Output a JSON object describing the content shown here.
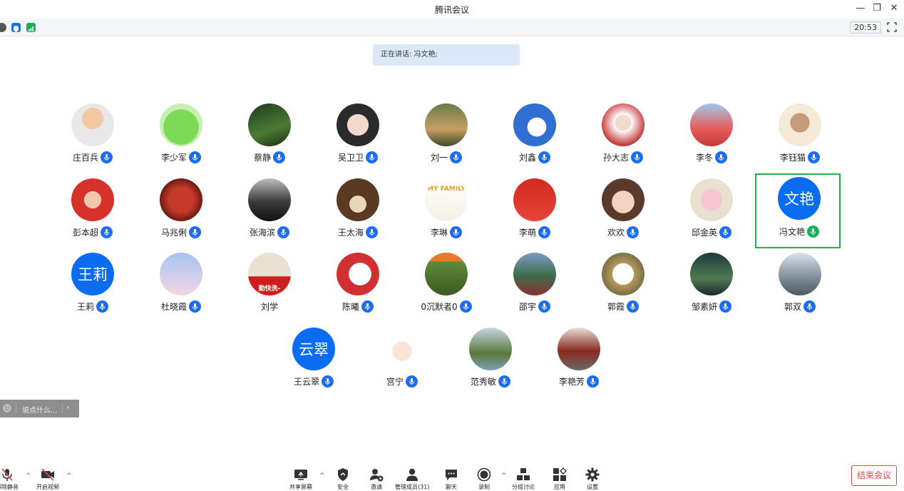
{
  "window": {
    "title": "腾讯会议"
  },
  "status": {
    "time": "20:53"
  },
  "speaking": {
    "text": "正在讲话: 冯文艳;"
  },
  "participants": [
    {
      "name": "庄百兵",
      "avatar": "photo"
    },
    {
      "name": "李少军",
      "avatar": "photo"
    },
    {
      "name": "蔡静",
      "avatar": "photo"
    },
    {
      "name": "吴卫卫",
      "avatar": "photo"
    },
    {
      "name": "刘一",
      "avatar": "photo"
    },
    {
      "name": "刘鑫",
      "avatar": "photo"
    },
    {
      "name": "孙大志",
      "avatar": "photo"
    },
    {
      "name": "李冬",
      "avatar": "photo"
    },
    {
      "name": "李钰猫",
      "avatar": "photo"
    },
    {
      "name": "彭本超",
      "avatar": "photo"
    },
    {
      "name": "马兆俐",
      "avatar": "photo"
    },
    {
      "name": "张海滨",
      "avatar": "photo"
    },
    {
      "name": "王太海",
      "avatar": "photo"
    },
    {
      "name": "李琳",
      "avatar": "photo",
      "avatar_caption": "MY FAMILY"
    },
    {
      "name": "李萌",
      "avatar": "photo"
    },
    {
      "name": "欢欢",
      "avatar": "photo"
    },
    {
      "name": "邱金英",
      "avatar": "photo"
    },
    {
      "name": "冯文艳",
      "avatar": "text",
      "avatar_text": "文艳",
      "speaking": true
    },
    {
      "name": "王莉",
      "avatar": "text",
      "avatar_text": "王莉"
    },
    {
      "name": "杜晓霞",
      "avatar": "photo"
    },
    {
      "name": "刘学",
      "avatar": "photo",
      "avatar_caption": "勤快洗-",
      "no_mic": true
    },
    {
      "name": "陈曦",
      "avatar": "photo"
    },
    {
      "name": "0沉默者0",
      "avatar": "photo"
    },
    {
      "name": "邵宇",
      "avatar": "photo"
    },
    {
      "name": "郭霞",
      "avatar": "photo"
    },
    {
      "name": "邹素妍",
      "avatar": "photo"
    },
    {
      "name": "郭双",
      "avatar": "photo"
    },
    {
      "name": "王云翠",
      "avatar": "text",
      "avatar_text": "云翠"
    },
    {
      "name": "宫宁",
      "avatar": "photo"
    },
    {
      "name": "范秀敏",
      "avatar": "photo"
    },
    {
      "name": "李艳芳",
      "avatar": "photo"
    }
  ],
  "chat": {
    "placeholder": "说点什么..."
  },
  "toolbar": {
    "mute": "解除静音",
    "video": "开启视频",
    "share": "共享屏幕",
    "security": "安全",
    "invite": "邀请",
    "members": "管理成员(31)",
    "chat": "聊天",
    "record": "录制",
    "breakout": "分组讨论",
    "apps": "应用",
    "settings": "设置",
    "end": "结束会议"
  },
  "colors": {
    "accent": "#1b6ef3",
    "speaking_border": "#22b14c",
    "end": "#e24a4a"
  }
}
